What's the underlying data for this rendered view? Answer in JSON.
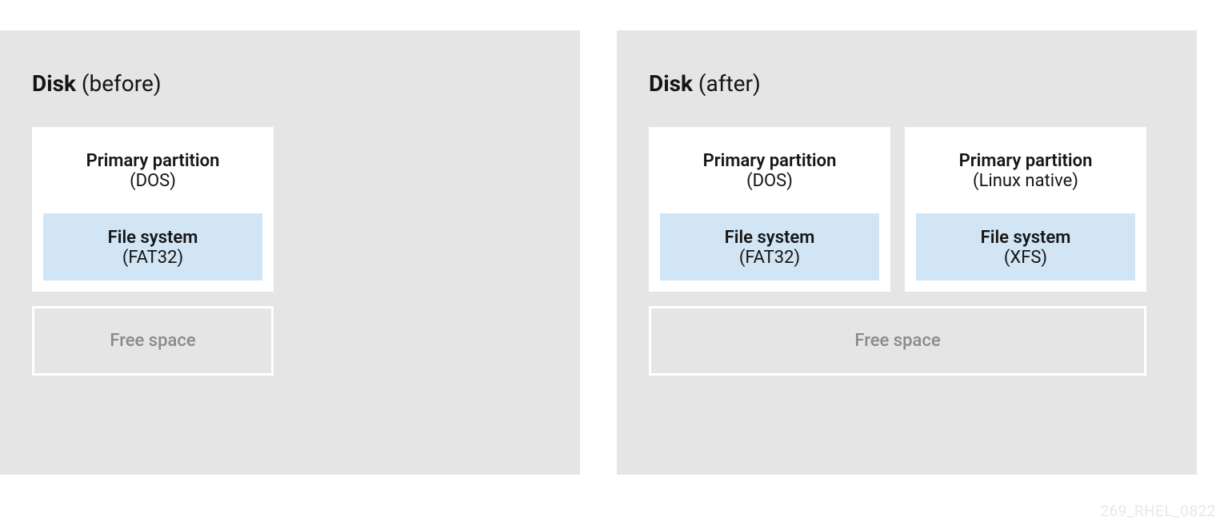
{
  "before": {
    "title_bold": "Disk",
    "title_light": " (before)",
    "partitions": [
      {
        "title": "Primary partition",
        "subtitle": "(DOS)",
        "fs_title": "File system",
        "fs_sub": "(FAT32)"
      }
    ],
    "free_label": "Free space"
  },
  "after": {
    "title_bold": "Disk",
    "title_light": " (after)",
    "partitions": [
      {
        "title": "Primary partition",
        "subtitle": "(DOS)",
        "fs_title": "File system",
        "fs_sub": "(FAT32)"
      },
      {
        "title": "Primary partition",
        "subtitle": "(Linux native)",
        "fs_title": "File system",
        "fs_sub": "(XFS)"
      }
    ],
    "free_label": "Free space"
  },
  "watermark": "269_RHEL_0822"
}
